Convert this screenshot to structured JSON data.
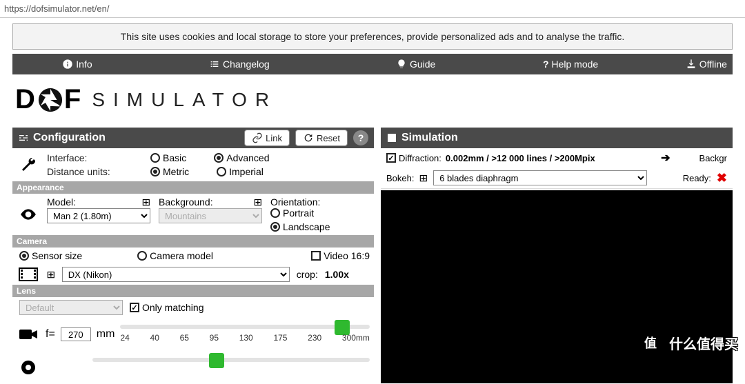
{
  "url": "https://dofsimulator.net/en/",
  "cookie_notice": "This site uses cookies and local storage to store your preferences, provide personalized ads and to analyse the traffic.",
  "topnav": {
    "info": "Info",
    "changelog": "Changelog",
    "guide": "Guide",
    "help_mode": "Help mode",
    "offline": "Offline"
  },
  "logo": {
    "word": "SIMULATOR"
  },
  "config": {
    "title": "Configuration",
    "link_btn": "Link",
    "reset_btn": "Reset",
    "interface_label": "Interface:",
    "interface_basic": "Basic",
    "interface_advanced": "Advanced",
    "distance_label": "Distance units:",
    "distance_metric": "Metric",
    "distance_imperial": "Imperial",
    "appearance": {
      "label": "Appearance",
      "model_label": "Model:",
      "model_value": "Man 2 (1.80m)",
      "background_label": "Background:",
      "background_value": "Mountains",
      "orientation_label": "Orientation:",
      "orientation_portrait": "Portrait",
      "orientation_landscape": "Landscape"
    },
    "camera": {
      "label": "Camera",
      "sensor_size": "Sensor size",
      "camera_model": "Camera model",
      "video": "Video 16:9",
      "sensor_value": "DX (Nikon)",
      "crop_label": "crop:",
      "crop_value": "1.00x"
    },
    "lens": {
      "label": "Lens",
      "default": "Default",
      "only_matching": "Only matching",
      "f_prefix": "f=",
      "f_value": "270",
      "f_unit": "mm",
      "ticks": [
        "24",
        "40",
        "65",
        "95",
        "130",
        "175",
        "230",
        "300mm"
      ]
    }
  },
  "sim": {
    "title": "Simulation",
    "diffraction_label": "Diffraction:",
    "diffraction_value": "0.002mm / >12 000 lines / >200Mpix",
    "background_peek": "Backgr",
    "bokeh_label": "Bokeh:",
    "bokeh_value": "6 blades diaphragm",
    "ready_label": "Ready:"
  },
  "watermark": {
    "badge": "值",
    "text": "什么值得买"
  }
}
